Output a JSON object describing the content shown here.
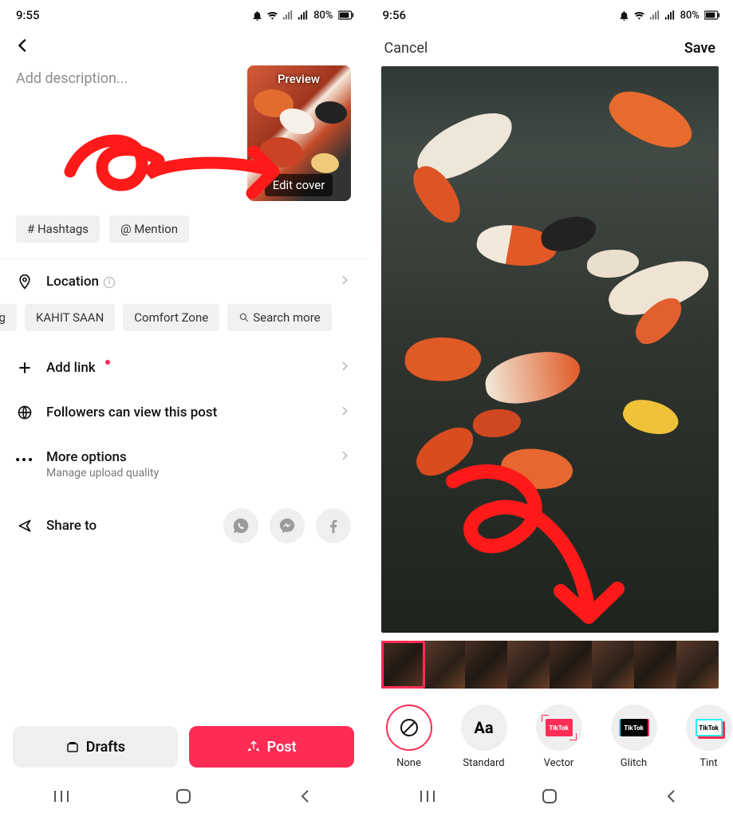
{
  "left": {
    "status_time": "9:55",
    "battery": "80%",
    "description_placeholder": "Add description...",
    "preview_label": "Preview",
    "edit_cover_label": "Edit cover",
    "hashtag_chip": "# Hashtags",
    "mention_chip": "@ Mention",
    "location_label": "Location",
    "location_chips": [
      "Lang",
      "KAHIT SAAN",
      "Comfort Zone",
      "Search more"
    ],
    "add_link_label": "Add link",
    "privacy_label": "Followers can view this post",
    "more_label": "More options",
    "more_sub": "Manage upload quality",
    "share_label": "Share to",
    "drafts_btn": "Drafts",
    "post_btn": "Post"
  },
  "right": {
    "status_time": "9:56",
    "battery": "80%",
    "cancel": "Cancel",
    "save": "Save",
    "filters": [
      {
        "label": "None"
      },
      {
        "label": "Standard"
      },
      {
        "label": "Vector"
      },
      {
        "label": "Glitch"
      },
      {
        "label": "Tint"
      }
    ]
  }
}
